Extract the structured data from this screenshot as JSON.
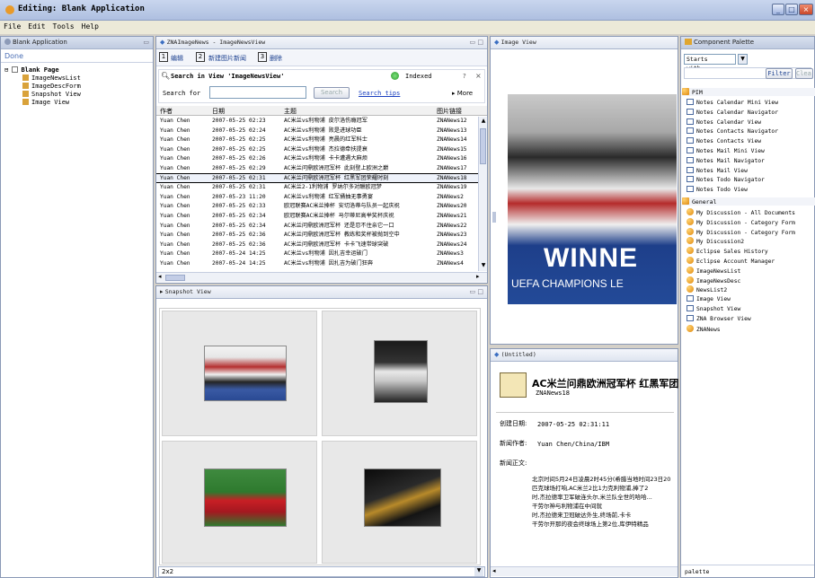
{
  "window": {
    "title": "Editing: Blank Application"
  },
  "menu": [
    "File",
    "Edit",
    "Tools",
    "Help"
  ],
  "left_panel": {
    "tab": "Blank Application",
    "status": "Done",
    "tree": {
      "root": "Blank Page",
      "children": [
        "ImageNewsList",
        "ImageDescForm",
        "Snapshot View",
        "Image View"
      ]
    }
  },
  "list_view": {
    "tab": "ZNAImageNews - ImageNewsView",
    "toolbar": [
      "编辑",
      "新建图片新闻",
      "删除"
    ],
    "search": {
      "title": "Search in View 'ImageNewsView'",
      "indexed": "Indexed",
      "label": "Search for",
      "value": "",
      "button": "Search",
      "tips": "Search tips",
      "more": "More",
      "help": "?"
    },
    "columns": [
      "作者",
      "日期",
      "主题",
      "图片链接"
    ],
    "rows": [
      [
        "Yuan Chen",
        "2007-05-25 02:23",
        "AC米兰vs利物浦 皮尔洛伤瘾冠军",
        "ZNANews12"
      ],
      [
        "Yuan Chen",
        "2007-05-25 02:24",
        "AC米兰vs利物浦 败是进球功臣",
        "ZNANews13"
      ],
      [
        "Yuan Chen",
        "2007-05-25 02:25",
        "AC米兰vs利物浦 亮晨的红军科士",
        "ZNANews14"
      ],
      [
        "Yuan Chen",
        "2007-05-25 02:25",
        "AC米兰vs利物浦 杰拉德牵扶提衰",
        "ZNANews15"
      ],
      [
        "Yuan Chen",
        "2007-05-25 02:26",
        "AC米兰vs利物浦 卡卡遭遇大麻烦",
        "ZNANews16"
      ],
      [
        "Yuan Chen",
        "2007-05-25 02:29",
        "AC米兰问鼎欧洲冠军杯 此刻登上欧洲之巅",
        "ZNANews17"
      ],
      [
        "Yuan Chen",
        "2007-05-25 02:31",
        "AC米兰问鼎欧洲冠军杯 红黑军团荣耀时刻",
        "ZNANews18"
      ],
      [
        "Yuan Chen",
        "2007-05-25 02:31",
        "AC米兰2-1利物浦 罗纳尔多对酬欧冠梦",
        "ZNANews19"
      ],
      [
        "Yuan Chen",
        "2007-05-23 11:20",
        "AC米兰vs利物浦 红军捅抽无事勇宴",
        "ZNANews2"
      ],
      [
        "Yuan Chen",
        "2007-05-25 02:33",
        "欧冠联赛AC米兰捧杯 安切洛蒂与队员一起庆祝",
        "ZNANews20"
      ],
      [
        "Yuan Chen",
        "2007-05-25 02:34",
        "欧冠联赛AC米兰捧杯 马尔蒂尼高举奖杯庆祝",
        "ZNANews21"
      ],
      [
        "Yuan Chen",
        "2007-05-25 02:34",
        "AC米兰问鼎欧洲冠军杯 还是忍不住亲它一口",
        "ZNANews22"
      ],
      [
        "Yuan Chen",
        "2007-05-25 02:36",
        "AC米兰问鼎欧洲冠军杯 教练和奖杯被抛到空中",
        "ZNANews23"
      ],
      [
        "Yuan Chen",
        "2007-05-25 02:36",
        "AC米兰问鼎欧洲冠军杯 卡卡飞速带球突破",
        "ZNANews24"
      ],
      [
        "Yuan Chen",
        "2007-05-24 14:25",
        "AC米兰vs利物浦 因扎吉幸运破门",
        "ZNANews3"
      ],
      [
        "Yuan Chen",
        "2007-05-24 14:25",
        "AC米兰vs利物浦 因扎吉为破门狂奔",
        "ZNANews4"
      ]
    ],
    "selected_row": 6
  },
  "snapshot_view": {
    "tab": "Snapshot View",
    "layout": "2x2",
    "footer": "2x2"
  },
  "image_view": {
    "tab": "Image View",
    "banner_big": "WINNE",
    "banner_small": "UEFA CHAMPIONS LE"
  },
  "untitled": {
    "tab": "(Untitled)",
    "headline": "AC米兰问鼎欧洲冠军杯 红黑军团",
    "sub": "ZNANews18",
    "date_label": "创建日期:",
    "date_value": "2007-05-25 02:31:11",
    "author_label": "新闻作者:",
    "author_value": "Yuan Chen/China/IBM",
    "body_label": "新闻正文:",
    "body": [
      "北京时间5月24日凌晨2时45分(希腊当地时间23日20",
      "匹克球场打响,AC米兰2比1力克利物浦,捧了2",
      "时,杰拉德率卫军破连头尔,米兰队全世的哈哈...",
      "干劳尔神与利物浦在中间就",
      "时,杰拉德来卫冠破达外生,终场前,卡卡",
      "干劳尔开那的夜会终球场上第2位,库伊特精品"
    ]
  },
  "palette": {
    "tab": "Component Palette",
    "select": "Starts with...",
    "filter_btn": "Filter",
    "clear_btn": "Clear",
    "group1": "PIM",
    "items1": [
      "Notes Calendar Mini View",
      "Notes Calendar Navigator",
      "Notes Calendar View",
      "Notes Contacts Navigator",
      "Notes Contacts View",
      "Notes Mail Mini View",
      "Notes Mail Navigator",
      "Notes Mail View",
      "Notes Todo Navigator",
      "Notes Todo View"
    ],
    "group2": "General",
    "items2": [
      {
        "label": "My Discussion - All Documents",
        "icon": "orb"
      },
      {
        "label": "My Discussion - Category Form",
        "icon": "orb"
      },
      {
        "label": "My Discussion - Category Form",
        "icon": "orb"
      },
      {
        "label": "My Discussion2",
        "icon": "orb"
      },
      {
        "label": "Eclipse Sales History",
        "icon": "orb"
      },
      {
        "label": "Eclipse Account Manager",
        "icon": "orb"
      },
      {
        "label": "ImageNewsList",
        "icon": "orb"
      },
      {
        "label": "ImageNewsDesc",
        "icon": "orb"
      },
      {
        "label": "NewsList2",
        "icon": "orb"
      },
      {
        "label": "Image View",
        "icon": "square"
      },
      {
        "label": "Snapshot View",
        "icon": "square"
      },
      {
        "label": "ZNA Browser View",
        "icon": "square"
      },
      {
        "label": "ZNANews",
        "icon": "orb"
      }
    ],
    "footer": "palette"
  }
}
